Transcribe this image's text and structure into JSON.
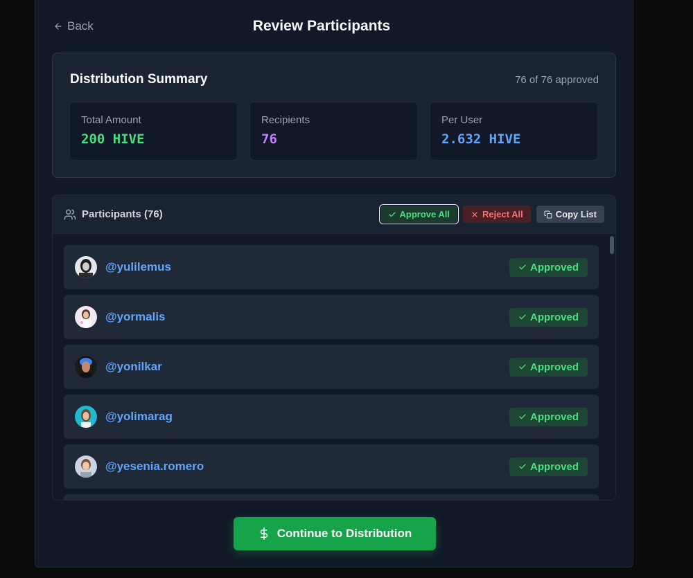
{
  "header": {
    "back_label": "Back",
    "title": "Review Participants"
  },
  "summary": {
    "title": "Distribution Summary",
    "approved_count": "76 of 76 approved",
    "stats": [
      {
        "label": "Total Amount",
        "value": "200 HIVE",
        "color": "#4ade80"
      },
      {
        "label": "Recipients",
        "value": "76",
        "color": "#c084fc"
      },
      {
        "label": "Per User",
        "value": "2.632 HIVE",
        "color": "#60a5fa"
      }
    ]
  },
  "participants": {
    "title": "Participants (76)",
    "approve_all_label": "Approve All",
    "reject_all_label": "Reject All",
    "copy_list_label": "Copy List",
    "rows": [
      {
        "username": "@yulilemus",
        "status": "Approved"
      },
      {
        "username": "@yormalis",
        "status": "Approved"
      },
      {
        "username": "@yonilkar",
        "status": "Approved"
      },
      {
        "username": "@yolimarag",
        "status": "Approved"
      },
      {
        "username": "@yesenia.romero",
        "status": "Approved"
      }
    ]
  },
  "continue_label": "Continue to Distribution",
  "icons": {
    "back": "arrow-left-icon",
    "users": "users-icon",
    "check": "check-icon",
    "x": "x-icon",
    "copy": "copy-icon",
    "dollar": "dollar-icon"
  },
  "colors": {
    "accent": "#16a34a",
    "approved": "#4ade80",
    "rejected": "#f87171",
    "link": "#60a5fa"
  }
}
